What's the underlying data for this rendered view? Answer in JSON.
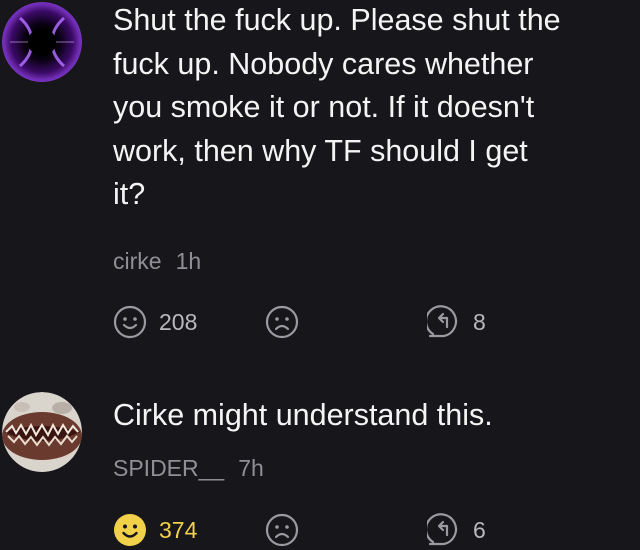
{
  "comments": [
    {
      "text_lines": [
        "Shut the fuck up. Please shut the",
        "fuck up. Nobody cares whether",
        "you smoke it or not. If it doesn't",
        "work, then why TF should I get",
        "it?"
      ],
      "author": "cirke",
      "time": "1h",
      "like_count": "208",
      "reply_count": "8",
      "avatar_icon": "purple-orb-avatar",
      "liked": false
    },
    {
      "text_lines": [
        "Cirke might understand this."
      ],
      "author": "SPIDER__",
      "time": "7h",
      "like_count": "374",
      "reply_count": "6",
      "avatar_icon": "creature-mouth-avatar",
      "liked": true
    }
  ],
  "colors": {
    "background": "#17171b",
    "text": "#f4f4f4",
    "muted": "#8f8f95",
    "icon": "#9a9aa0",
    "like_active": "#f1d04a"
  }
}
